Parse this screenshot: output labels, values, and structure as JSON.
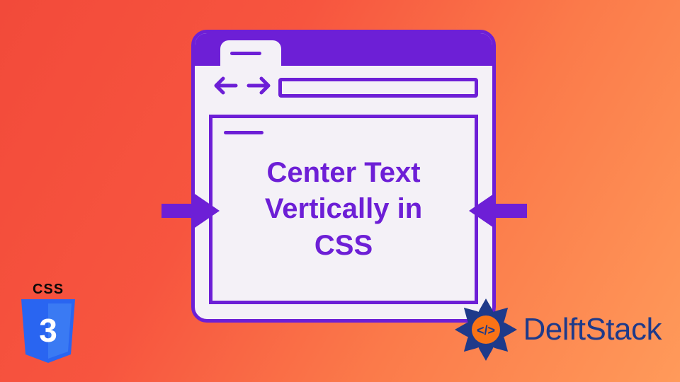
{
  "colors": {
    "accent_purple": "#6d1fd6",
    "panel_bg": "#f4f1f7",
    "css_shield_blue": "#2965f1",
    "css_shield_blue_light": "#3a7af3",
    "delft_blue": "#1e3a8a",
    "delft_orange": "#f97316"
  },
  "main": {
    "heading": "Center Text Vertically in CSS"
  },
  "css_badge": {
    "label": "CSS",
    "shield_glyph": "3"
  },
  "brand": {
    "name": "DelftStack",
    "mark_glyph": "</>"
  },
  "icons": {
    "back": "back-arrow-icon",
    "forward": "forward-arrow-icon",
    "squeeze_left": "arrow-right-solid-icon",
    "squeeze_right": "arrow-left-solid-icon"
  }
}
